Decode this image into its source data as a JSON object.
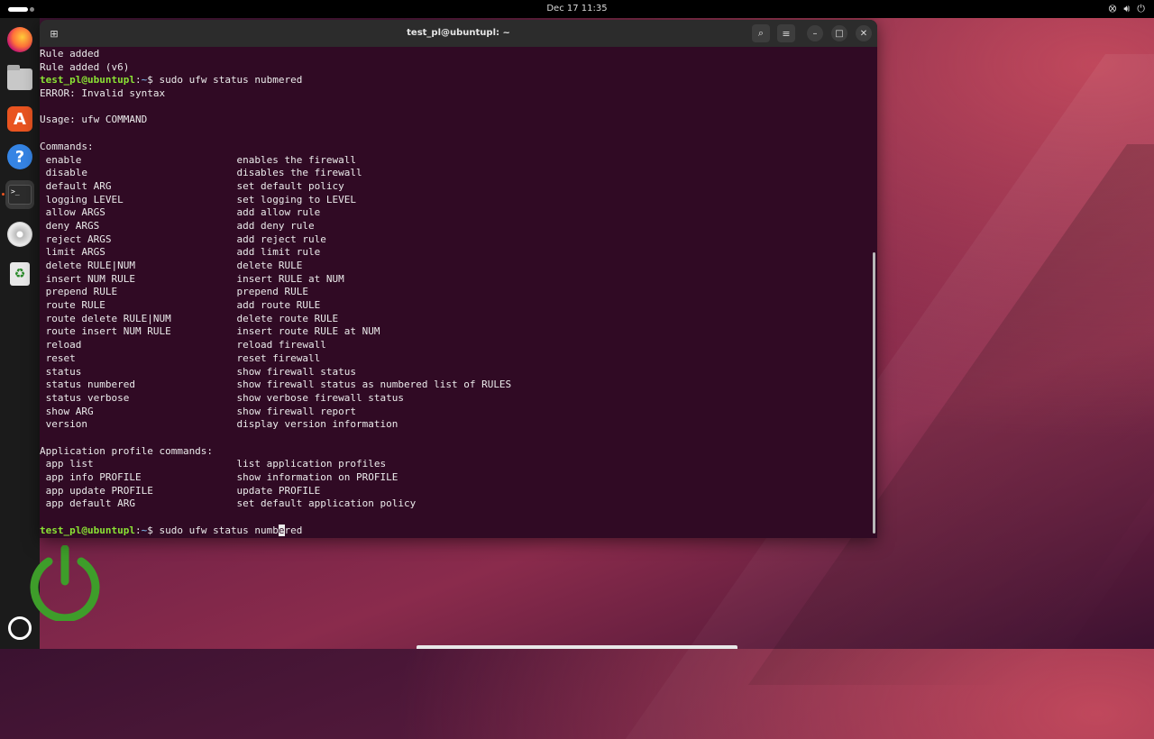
{
  "topbar": {
    "clock": "Dec 17  11:35"
  },
  "window": {
    "title": "test_pl@ubuntupl: ~"
  },
  "terminal": {
    "prompt_user": "test_pl@ubuntupl",
    "prompt_sep": ":",
    "prompt_path": "~",
    "prompt_dollar": "$ ",
    "lines": [
      {
        "type": "out",
        "text": "Rule added"
      },
      {
        "type": "out",
        "text": "Rule added (v6)"
      },
      {
        "type": "cmd",
        "text": "sudo ufw status nubmered"
      },
      {
        "type": "out",
        "text": "ERROR: Invalid syntax"
      },
      {
        "type": "out",
        "text": ""
      },
      {
        "type": "out",
        "text": "Usage: ufw COMMAND"
      },
      {
        "type": "out",
        "text": ""
      },
      {
        "type": "out",
        "text": "Commands:"
      },
      {
        "type": "out",
        "text": " enable                          enables the firewall"
      },
      {
        "type": "out",
        "text": " disable                         disables the firewall"
      },
      {
        "type": "out",
        "text": " default ARG                     set default policy"
      },
      {
        "type": "out",
        "text": " logging LEVEL                   set logging to LEVEL"
      },
      {
        "type": "out",
        "text": " allow ARGS                      add allow rule"
      },
      {
        "type": "out",
        "text": " deny ARGS                       add deny rule"
      },
      {
        "type": "out",
        "text": " reject ARGS                     add reject rule"
      },
      {
        "type": "out",
        "text": " limit ARGS                      add limit rule"
      },
      {
        "type": "out",
        "text": " delete RULE|NUM                 delete RULE"
      },
      {
        "type": "out",
        "text": " insert NUM RULE                 insert RULE at NUM"
      },
      {
        "type": "out",
        "text": " prepend RULE                    prepend RULE"
      },
      {
        "type": "out",
        "text": " route RULE                      add route RULE"
      },
      {
        "type": "out",
        "text": " route delete RULE|NUM           delete route RULE"
      },
      {
        "type": "out",
        "text": " route insert NUM RULE           insert route RULE at NUM"
      },
      {
        "type": "out",
        "text": " reload                          reload firewall"
      },
      {
        "type": "out",
        "text": " reset                           reset firewall"
      },
      {
        "type": "out",
        "text": " status                          show firewall status"
      },
      {
        "type": "out",
        "text": " status numbered                 show firewall status as numbered list of RULES"
      },
      {
        "type": "out",
        "text": " status verbose                  show verbose firewall status"
      },
      {
        "type": "out",
        "text": " show ARG                        show firewall report"
      },
      {
        "type": "out",
        "text": " version                         display version information"
      },
      {
        "type": "out",
        "text": ""
      },
      {
        "type": "out",
        "text": "Application profile commands:"
      },
      {
        "type": "out",
        "text": " app list                        list application profiles"
      },
      {
        "type": "out",
        "text": " app info PROFILE                show information on PROFILE"
      },
      {
        "type": "out",
        "text": " app update PROFILE              update PROFILE"
      },
      {
        "type": "out",
        "text": " app default ARG                 set default application policy"
      },
      {
        "type": "out",
        "text": ""
      }
    ],
    "current_input_before": "sudo ufw status numb",
    "current_input_cursor": "e",
    "current_input_after": "red"
  },
  "icons": {
    "dock": [
      "firefox-icon",
      "files-icon",
      "app-center-icon",
      "help-icon",
      "terminal-icon",
      "disc-icon",
      "trash-icon",
      "show-apps-icon"
    ],
    "titlebar": [
      "new-tab-icon",
      "search-icon",
      "menu-icon",
      "minimize-icon",
      "maximize-icon",
      "close-icon"
    ]
  },
  "colors": {
    "terminal_bg": "#300a24",
    "prompt_user": "#8ae234",
    "prompt_path": "#729fcf",
    "accent": "#e95420"
  }
}
